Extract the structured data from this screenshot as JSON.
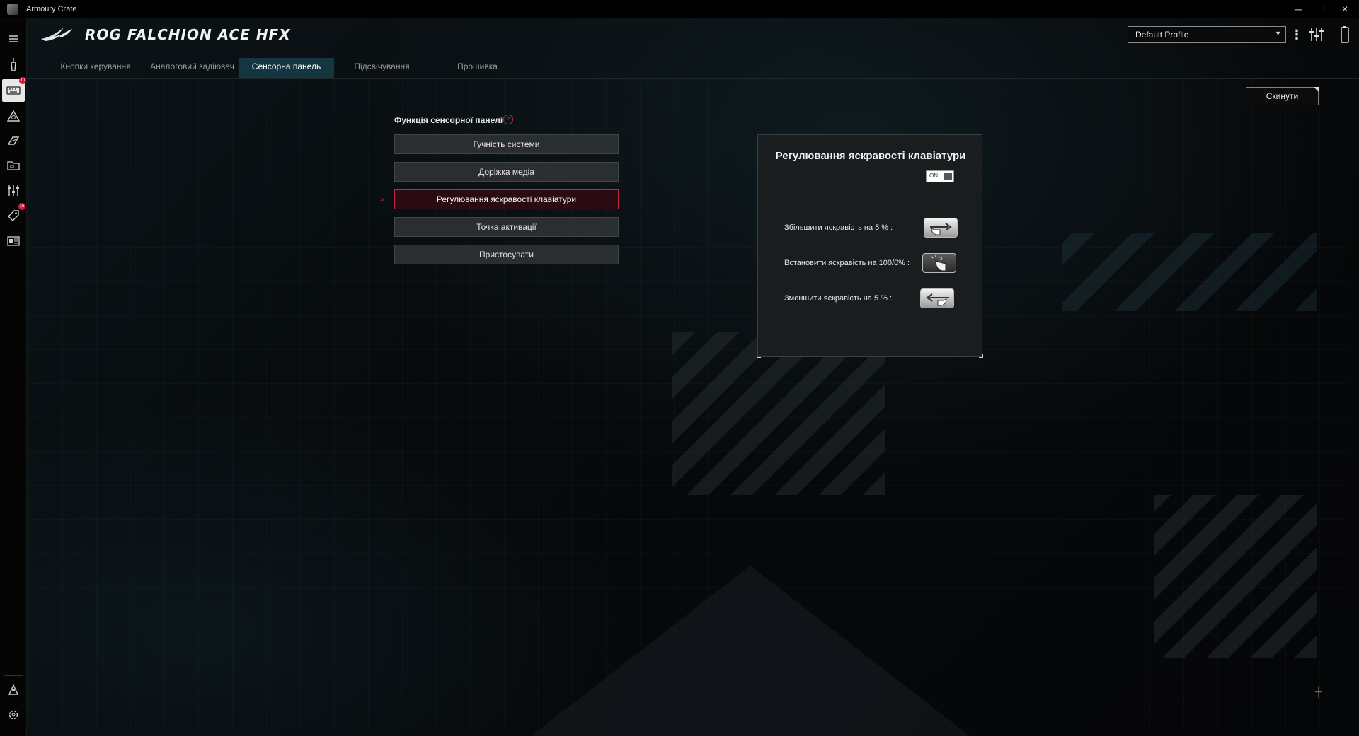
{
  "window": {
    "title": "Armoury Crate",
    "minimize": "─",
    "maximize": "☐",
    "close": "✕"
  },
  "header": {
    "product_title": "ROG FALCHION ACE HFX",
    "profile": {
      "selected": "Default Profile"
    }
  },
  "sidebar": {
    "items": [
      {
        "name": "menu",
        "icon": "hamburger-icon"
      },
      {
        "name": "device-tool",
        "icon": "device-icon"
      },
      {
        "name": "keyboard",
        "icon": "keyboard-icon",
        "badge": "10"
      },
      {
        "name": "aura",
        "icon": "aura-icon"
      },
      {
        "name": "gamevisual",
        "icon": "gamevisual-icon"
      },
      {
        "name": "scenario",
        "icon": "folder-icon"
      },
      {
        "name": "settings-tune",
        "icon": "sliders-icon"
      },
      {
        "name": "deals",
        "icon": "tag-icon",
        "badge": "16"
      },
      {
        "name": "news",
        "icon": "news-icon"
      },
      {
        "name": "user",
        "icon": "user-icon"
      },
      {
        "name": "settings",
        "icon": "gear-icon"
      }
    ]
  },
  "tabs": [
    {
      "label": "Кнопки керування",
      "active": false
    },
    {
      "label": "Аналоговий задіювач",
      "active": false
    },
    {
      "label": "Сенсорна панель",
      "active": true
    },
    {
      "label": "Підсвічування",
      "active": false
    },
    {
      "label": "Прошивка",
      "active": false
    }
  ],
  "reset_button": "Скинути",
  "touchpanel": {
    "section_title": "Функція сенсорної панелі",
    "help": "?",
    "functions": [
      {
        "label": "Гучність системи",
        "selected": false
      },
      {
        "label": "Доріжка медіа",
        "selected": false
      },
      {
        "label": "Регулювання яскравості клавіатури",
        "selected": true
      },
      {
        "label": "Точка активації",
        "selected": false
      },
      {
        "label": "Пристосувати",
        "selected": false
      }
    ]
  },
  "detail": {
    "title": "Регулювання яскравості клавіатури",
    "toggle": "ON",
    "gestures": [
      {
        "label": "Збільшити яскравість на 5 % :",
        "icon": "swipe-right-icon"
      },
      {
        "label": "Встановити яскравість на 100/0% :",
        "icon": "double-tap-icon"
      },
      {
        "label": "Зменшити яскравість на 5 % :",
        "icon": "swipe-left-icon"
      }
    ]
  },
  "colors": {
    "accent_red": "#cf2342",
    "accent_cyan": "#2fd0e2",
    "active_tab_bg": "#143641"
  }
}
